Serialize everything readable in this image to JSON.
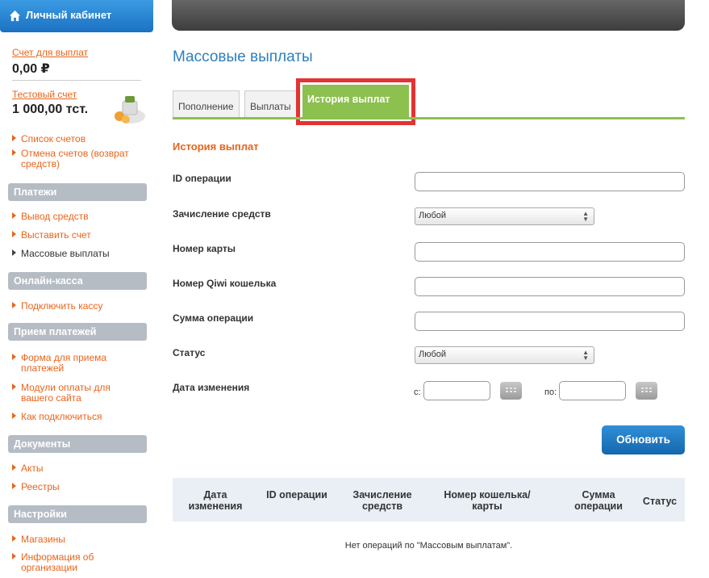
{
  "sidebar": {
    "cabinet_title": "Личный кабинет",
    "account1": {
      "link": "Счет для выплат",
      "balance": "0,00 ₽"
    },
    "account2": {
      "link": "Тестовый счет",
      "balance": "1 000,00 тст."
    },
    "accounts_items": [
      {
        "label": "Список счетов"
      },
      {
        "label": "Отмена счетов (возврат средств)"
      }
    ],
    "sections": [
      {
        "title": "Платежи",
        "items": [
          "Вывод средств",
          "Выставить счет",
          "Массовые выплаты"
        ]
      },
      {
        "title": "Онлайн-касса",
        "items": [
          "Подключить кассу"
        ]
      },
      {
        "title": "Прием платежей",
        "items": [
          "Форма для приема платежей",
          "Модули оплаты для вашего сайта",
          "Как подключиться"
        ]
      },
      {
        "title": "Документы",
        "items": [
          "Акты",
          "Реестры"
        ]
      },
      {
        "title": "Настройки",
        "items": [
          "Магазины",
          "Информация об организации"
        ]
      }
    ]
  },
  "page": {
    "title": "Массовые выплаты",
    "tabs": [
      "Пополнение",
      "Выплаты",
      "История выплат"
    ],
    "section_title": "История выплат"
  },
  "form": {
    "op_id_label": "ID операции",
    "credit_label": "Зачисление средств",
    "credit_value": "Любой",
    "card_label": "Номер карты",
    "qiwi_label": "Номер Qiwi кошелька",
    "sum_label": "Сумма операции",
    "status_label": "Статус",
    "status_value": "Любой",
    "date_label": "Дата изменения",
    "date_from": "с:",
    "date_to": "по:",
    "update_button": "Обновить"
  },
  "table": {
    "headers": [
      "Дата изменения",
      "ID операции",
      "Зачисление средств",
      "Номер кошелька/ карты",
      "Сумма операции",
      "Статус"
    ],
    "empty_text": "Нет операций по \"Массовым выплатам\"."
  },
  "colors": {
    "accent_orange": "#e8641b",
    "accent_green": "#8cc04f",
    "accent_blue": "#2e7fbf",
    "highlight_red": "#e53232"
  }
}
